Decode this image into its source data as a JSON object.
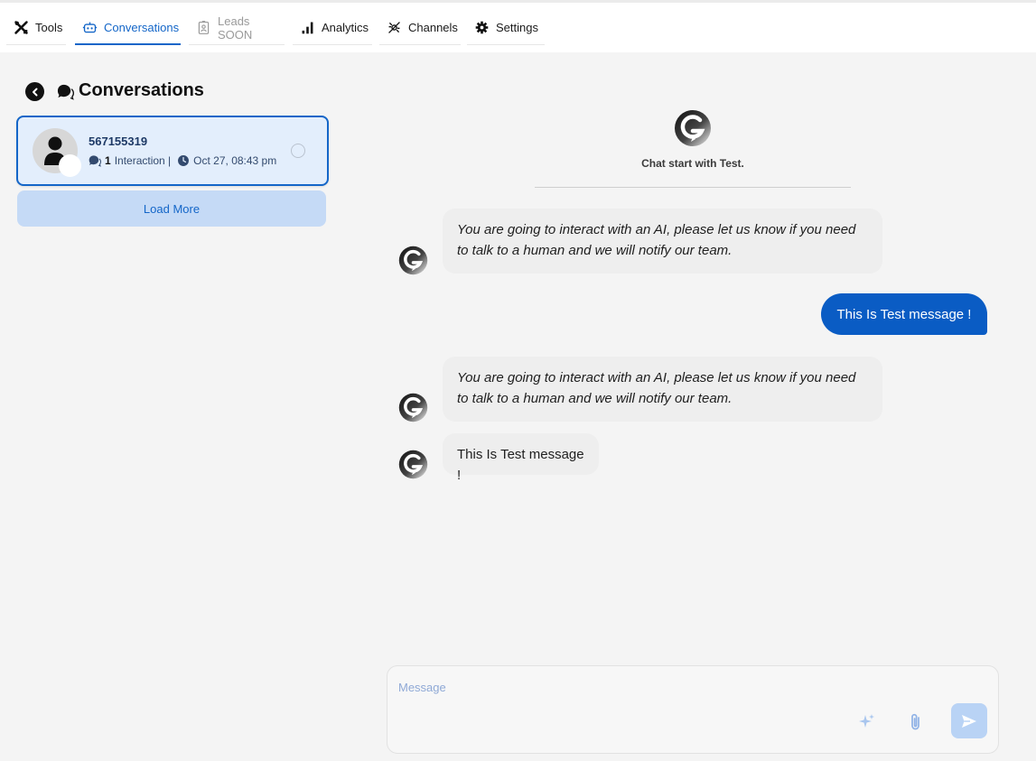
{
  "nav": {
    "tabs": [
      {
        "label": "Tools",
        "icon": "tools-icon",
        "state": "normal"
      },
      {
        "label": "Conversations",
        "icon": "robot-icon",
        "state": "active"
      },
      {
        "label": "Leads SOON",
        "icon": "contact-card-icon",
        "state": "disabled"
      },
      {
        "label": "Analytics",
        "icon": "bar-chart-icon",
        "state": "normal"
      },
      {
        "label": "Channels",
        "icon": "connections-icon",
        "state": "normal"
      },
      {
        "label": "Settings",
        "icon": "gear-icon",
        "state": "normal"
      }
    ]
  },
  "sidebar": {
    "title": "Conversations",
    "title_icon": "chat-bubbles-icon",
    "back_icon": "chevron-left-icon",
    "conversations": [
      {
        "name": "567155319",
        "interaction_count": "1",
        "interaction_label": "Interaction |",
        "timestamp": "Oct 27, 08:43 pm",
        "selected": true
      }
    ],
    "load_more_label": "Load More"
  },
  "chat": {
    "start_text": "Chat start with Test.",
    "messages": [
      {
        "from": "bot",
        "text": "You are going to interact with an AI, please let us know if you need to talk to a human and we will notify our team."
      },
      {
        "from": "user",
        "text": "This Is Test message !"
      },
      {
        "from": "bot",
        "text": "You are going to interact with an AI, please let us know if you need to talk to a human and we will notify our team."
      },
      {
        "from": "bot",
        "text": "This Is Test message !"
      }
    ]
  },
  "composer": {
    "placeholder": "Message",
    "sparkle_icon": "sparkle-icon",
    "attach_icon": "paperclip-icon",
    "send_icon": "send-icon"
  },
  "colors": {
    "accent": "#1466c8",
    "user_bubble": "#0a5cc4",
    "card_bg": "#e3eefc",
    "load_more_bg": "#c5daf6",
    "send_bg": "#b9d3f5",
    "page_bg": "#f4f4f4"
  }
}
